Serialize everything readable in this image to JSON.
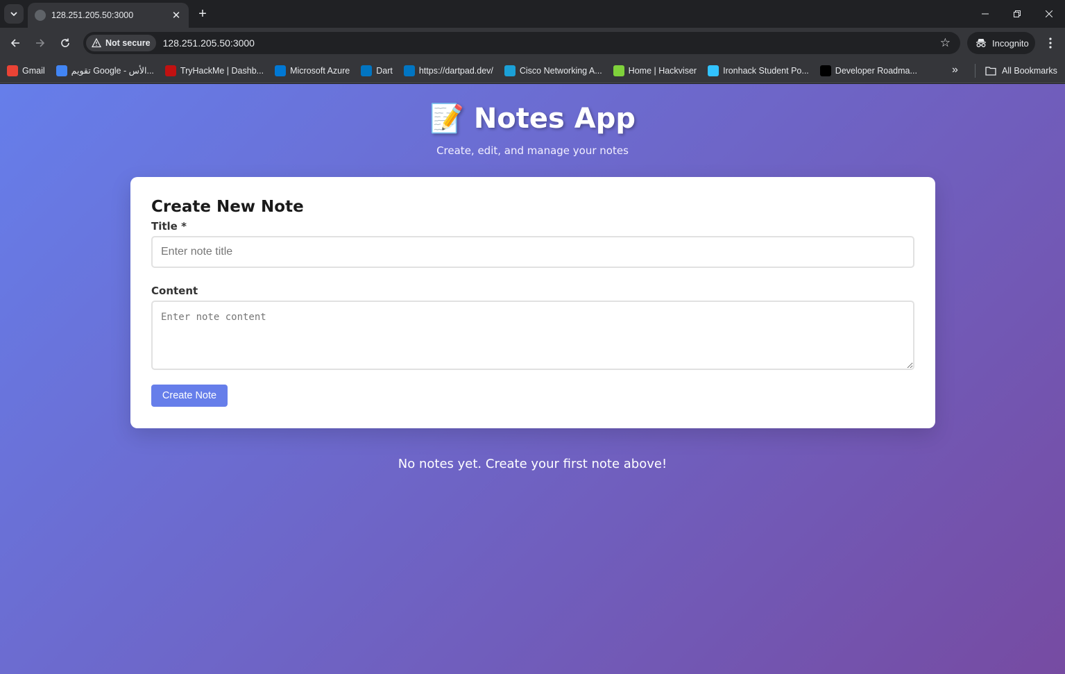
{
  "browser": {
    "tab": {
      "title": "128.251.205.50:3000"
    },
    "address": {
      "security_label": "Not secure",
      "url": "128.251.205.50:3000"
    },
    "profile_label": "Incognito",
    "bookmarks": [
      {
        "label": "Gmail",
        "icon": "gmail-icon",
        "color": "#ea4335"
      },
      {
        "label": "تقويم Google - الأس...",
        "icon": "calendar-icon",
        "color": "#4285f4"
      },
      {
        "label": "TryHackMe | Dashb...",
        "icon": "tryhackme-icon",
        "color": "#c11111"
      },
      {
        "label": "Microsoft Azure",
        "icon": "azure-icon",
        "color": "#0078d4"
      },
      {
        "label": "Dart",
        "icon": "dart-icon",
        "color": "#0175c2"
      },
      {
        "label": "https://dartpad.dev/",
        "icon": "dartpad-icon",
        "color": "#0175c2"
      },
      {
        "label": "Cisco Networking A...",
        "icon": "cisco-icon",
        "color": "#1ba0d7"
      },
      {
        "label": "Home | Hackviser",
        "icon": "hackviser-icon",
        "color": "#7fd13b"
      },
      {
        "label": "Ironhack Student Po...",
        "icon": "ironhack-icon",
        "color": "#32c3ff"
      },
      {
        "label": "Developer Roadma...",
        "icon": "roadmap-icon",
        "color": "#000000"
      }
    ],
    "all_bookmarks_label": "All Bookmarks"
  },
  "app": {
    "emoji": "📝",
    "title": "Notes App",
    "subtitle": "Create, edit, and manage your notes",
    "form": {
      "heading": "Create New Note",
      "title_label": "Title *",
      "title_placeholder": "Enter note title",
      "content_label": "Content",
      "content_placeholder": "Enter note content",
      "submit_label": "Create Note"
    },
    "empty_message": "No notes yet. Create your first note above!"
  },
  "colors": {
    "gradient_start": "#667eea",
    "gradient_end": "#764ba2",
    "button": "#667eea"
  }
}
